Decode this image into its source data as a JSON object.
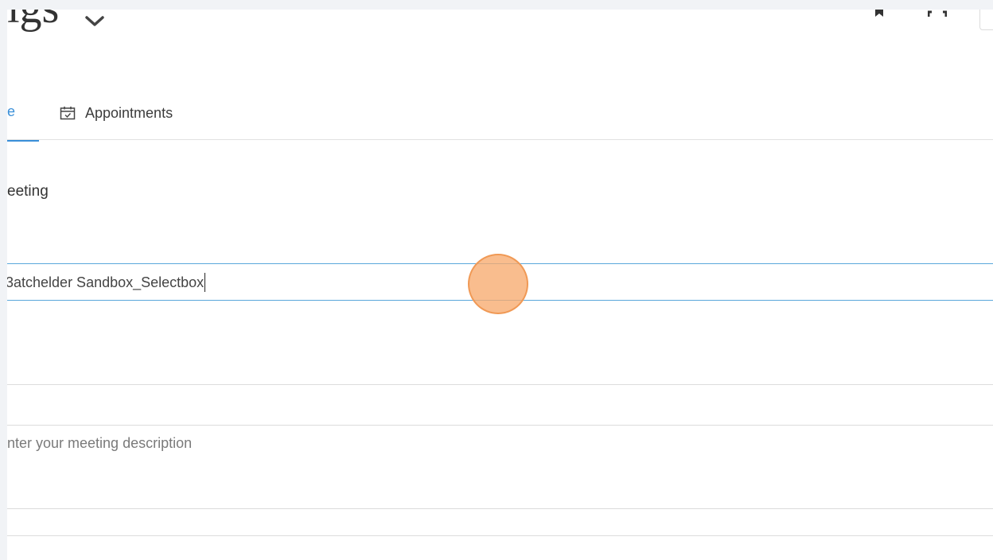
{
  "header": {
    "title": "igs",
    "icons": [
      "chevron-down-icon",
      "bookmark-icon",
      "expand-icon"
    ]
  },
  "tabs": [
    {
      "label": "e",
      "active": true
    },
    {
      "label": "Appointments",
      "icon": "calendar-icon",
      "active": false
    }
  ],
  "form": {
    "section_label": "eeting",
    "name_value": "3atchelder Sandbox_Selectbox",
    "description_placeholder": "nter your meeting description"
  },
  "colors": {
    "accent": "#3a8fd8",
    "input_border": "#5aa7db",
    "click_marker": "#f7aa6e"
  }
}
